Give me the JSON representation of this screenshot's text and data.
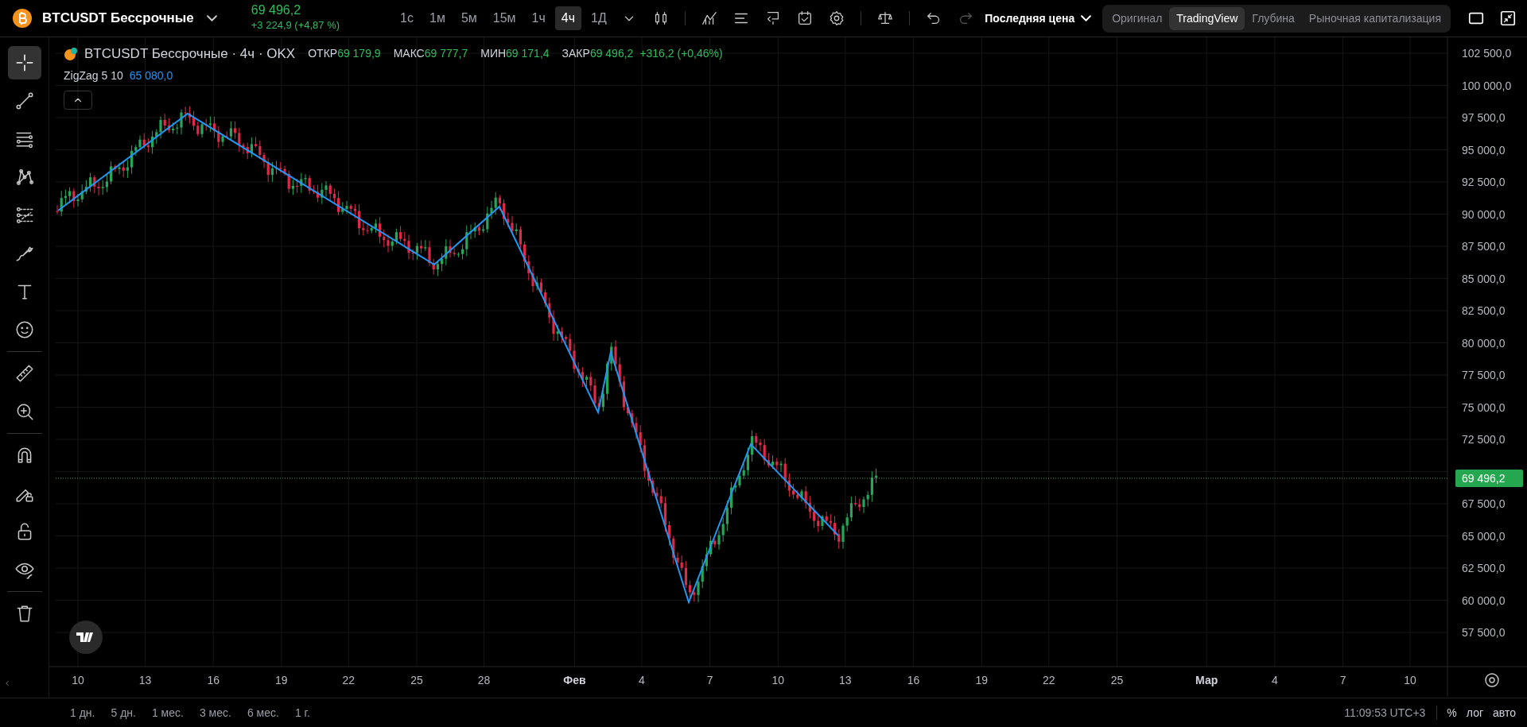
{
  "symbol": {
    "name": "BTCUSDT Бессрочные",
    "price": "69 496,2",
    "change": "+3 224,9 (+4,87 %)"
  },
  "intervals": [
    {
      "label": "1с",
      "selected": false
    },
    {
      "label": "1м",
      "selected": false
    },
    {
      "label": "5м",
      "selected": false
    },
    {
      "label": "15м",
      "selected": false
    },
    {
      "label": "1ч",
      "selected": false
    },
    {
      "label": "4ч",
      "selected": true
    },
    {
      "label": "1Д",
      "selected": false
    }
  ],
  "price_source": "Последняя цена",
  "view_tabs": [
    {
      "label": "Оригинал",
      "selected": false
    },
    {
      "label": "TradingView",
      "selected": true
    },
    {
      "label": "Глубина",
      "selected": false
    },
    {
      "label": "Рыночная капитализация",
      "selected": false
    }
  ],
  "tools": [
    {
      "kind": "crosshair",
      "selected": true
    },
    {
      "kind": "trend-line",
      "selected": false
    },
    {
      "kind": "lines",
      "selected": false
    },
    {
      "kind": "pattern",
      "selected": false
    },
    {
      "kind": "fib",
      "selected": false
    },
    {
      "kind": "brush",
      "selected": false
    },
    {
      "kind": "text",
      "selected": false
    },
    {
      "kind": "emoji",
      "selected": false
    },
    {
      "kind": "divider"
    },
    {
      "kind": "ruler",
      "selected": false
    },
    {
      "kind": "zoom",
      "selected": false
    },
    {
      "kind": "divider"
    },
    {
      "kind": "magnet",
      "selected": false
    },
    {
      "kind": "pencil-lock",
      "selected": false
    },
    {
      "kind": "lock",
      "selected": false
    },
    {
      "kind": "eye",
      "selected": false
    },
    {
      "kind": "divider"
    },
    {
      "kind": "trash",
      "selected": false
    }
  ],
  "legend": {
    "title": "BTCUSDT Бессрочные · 4ч · OKX",
    "ohlc": [
      {
        "label": "ОТКР",
        "value": "69 179,9"
      },
      {
        "label": "МАКС",
        "value": "69 777,7"
      },
      {
        "label": "МИН",
        "value": "69 171,4"
      },
      {
        "label": "ЗАКР",
        "value": "69 496,2"
      }
    ],
    "change": "+316,2 (+0,46%)"
  },
  "indicator": {
    "name": "ZigZag 5 10",
    "value": "65 080,0"
  },
  "price_axis": [
    "102 500,0",
    "100 000,0",
    "97 500,0",
    "95 000,0",
    "92 500,0",
    "90 000,0",
    "87 500,0",
    "85 000,0",
    "82 500,0",
    "80 000,0",
    "77 500,0",
    "75 000,0",
    "72 500,0",
    "67 500,0",
    "65 000,0",
    "62 500,0",
    "60 000,0",
    "57 500,0"
  ],
  "current_price": "69 496,2",
  "time_axis": [
    {
      "label": "10",
      "kind": "day"
    },
    {
      "label": "13",
      "kind": "day"
    },
    {
      "label": "16",
      "kind": "day"
    },
    {
      "label": "19",
      "kind": "day"
    },
    {
      "label": "22",
      "kind": "day"
    },
    {
      "label": "25",
      "kind": "day"
    },
    {
      "label": "28",
      "kind": "day"
    },
    {
      "label": "Фев",
      "kind": "month"
    },
    {
      "label": "4",
      "kind": "day"
    },
    {
      "label": "7",
      "kind": "day"
    },
    {
      "label": "10",
      "kind": "day"
    },
    {
      "label": "13",
      "kind": "day"
    },
    {
      "label": "16",
      "kind": "day"
    },
    {
      "label": "19",
      "kind": "day"
    },
    {
      "label": "22",
      "kind": "day"
    },
    {
      "label": "25",
      "kind": "day"
    },
    {
      "label": "Мар",
      "kind": "month"
    },
    {
      "label": "4",
      "kind": "day"
    },
    {
      "label": "7",
      "kind": "day"
    },
    {
      "label": "10",
      "kind": "day"
    }
  ],
  "ranges": [
    "1 дн.",
    "5 дн.",
    "1 мес.",
    "3 мес.",
    "6 мес.",
    "1 г."
  ],
  "clock": "11:09:53 UTC+3",
  "scale_buttons": [
    "%",
    "лог",
    "авто"
  ]
}
